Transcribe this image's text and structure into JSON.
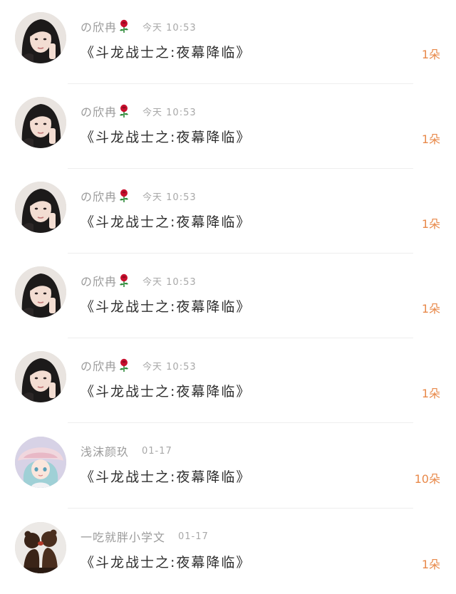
{
  "rows": [
    {
      "username": "の欣冉",
      "rose": true,
      "time": "今天 10:53",
      "message": "《斗龙战士之:夜幕降临》",
      "count": "1朵",
      "avatar": "girl-photo"
    },
    {
      "username": "の欣冉",
      "rose": true,
      "time": "今天 10:53",
      "message": "《斗龙战士之:夜幕降临》",
      "count": "1朵",
      "avatar": "girl-photo"
    },
    {
      "username": "の欣冉",
      "rose": true,
      "time": "今天 10:53",
      "message": "《斗龙战士之:夜幕降临》",
      "count": "1朵",
      "avatar": "girl-photo"
    },
    {
      "username": "の欣冉",
      "rose": true,
      "time": "今天 10:53",
      "message": "《斗龙战士之:夜幕降临》",
      "count": "1朵",
      "avatar": "girl-photo"
    },
    {
      "username": "の欣冉",
      "rose": true,
      "time": "今天 10:53",
      "message": "《斗龙战士之:夜幕降临》",
      "count": "1朵",
      "avatar": "girl-photo"
    },
    {
      "username": "浅沫颜玖",
      "rose": false,
      "time": "01-17",
      "message": "《斗龙战士之:夜幕降临》",
      "count": "10朵",
      "avatar": "anime-girl"
    },
    {
      "username": "一吃就胖小学文",
      "rose": false,
      "time": "01-17",
      "message": "《斗龙战士之:夜幕降临》",
      "count": "1朵",
      "avatar": "kissing-figurines"
    }
  ],
  "colors": {
    "count": "#e8894a",
    "username": "#9b9b9b",
    "message": "#2e2e2e",
    "divider": "#eeeeee",
    "rose": "#c8102e"
  },
  "icons": {
    "rose": "rose-icon"
  }
}
